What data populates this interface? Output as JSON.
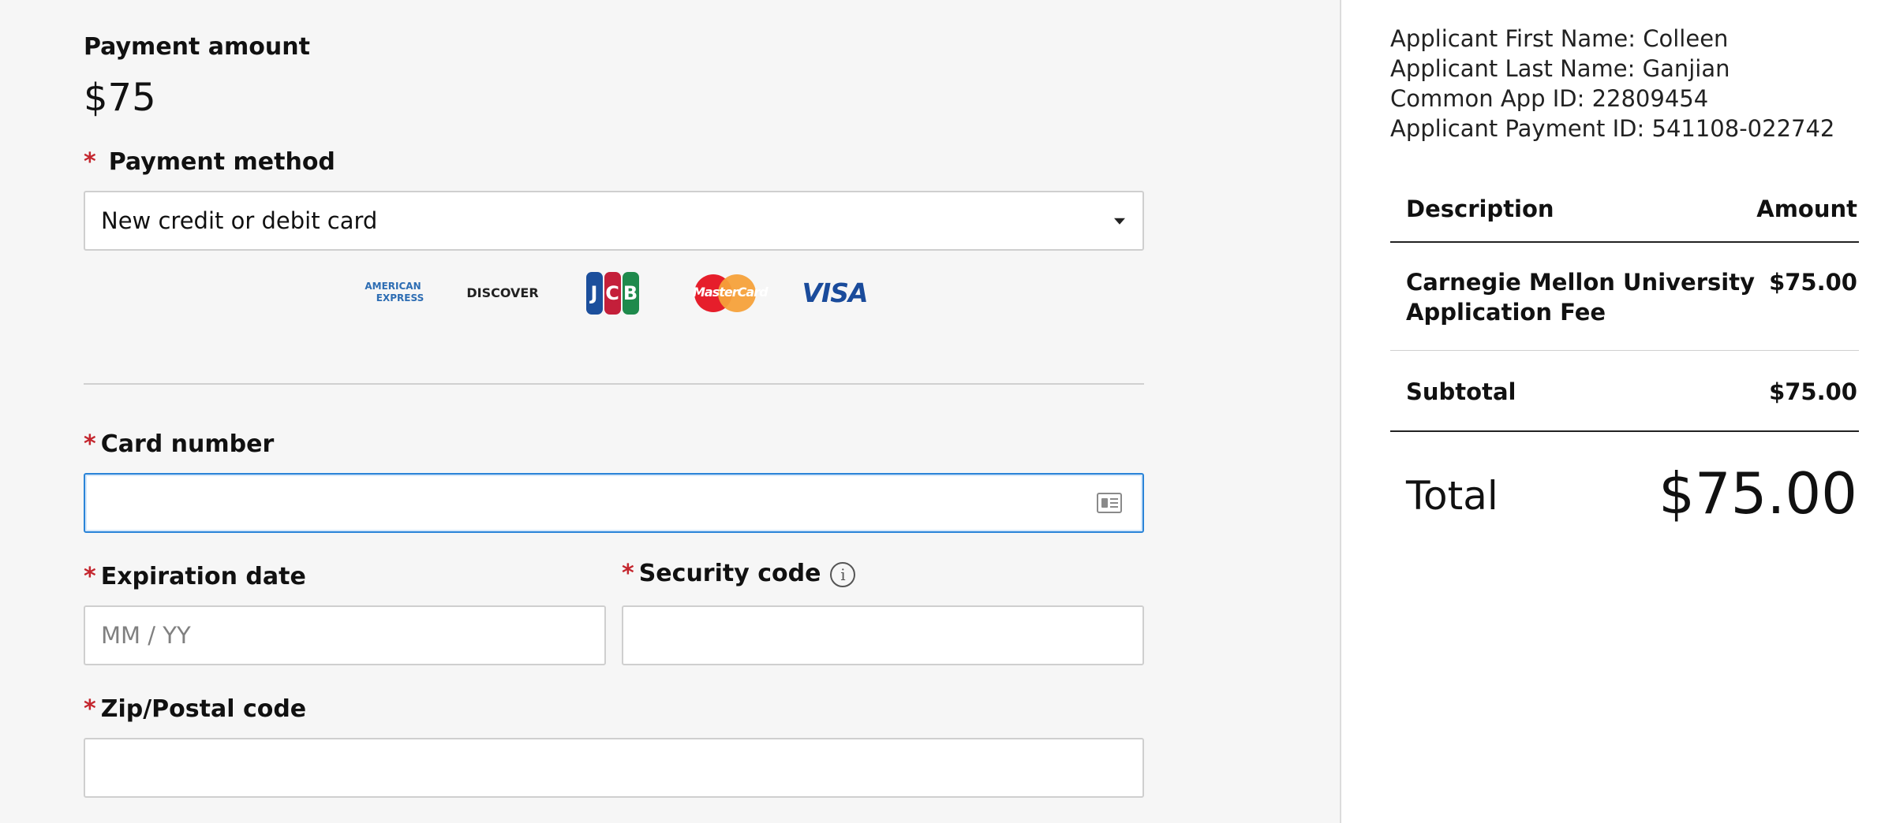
{
  "payment": {
    "amount_label": "Payment amount",
    "amount_value": "$75",
    "method_label": "Payment method",
    "method_selected": "New credit or debit card",
    "required_mark": "*"
  },
  "card_brands": {
    "amex_line1": "AMERICAN",
    "amex_line2": "EXPRESS",
    "discover": "DISCOVER",
    "jcb_letters": [
      "J",
      "C",
      "B"
    ],
    "mastercard": "MasterCard",
    "visa": "VISA"
  },
  "card_form": {
    "card_number_label": "Card number",
    "card_number_value": "",
    "expiration_label": "Expiration date",
    "expiration_placeholder": "MM / YY",
    "security_label": "Security code",
    "security_info_glyph": "i",
    "zip_label": "Zip/Postal code",
    "zip_value": ""
  },
  "applicant": {
    "first_name_line": "Applicant First Name: Colleen",
    "last_name_line": "Applicant Last Name: Ganjian",
    "common_app_line": "Common App ID: 22809454",
    "payment_id_line": "Applicant Payment ID: 541108-022742"
  },
  "summary": {
    "col_description": "Description",
    "col_amount": "Amount",
    "items": [
      {
        "description_line1": "Carnegie Mellon University",
        "description_line2": "Application Fee",
        "amount": "$75.00"
      }
    ],
    "subtotal_label": "Subtotal",
    "subtotal_value": "$75.00",
    "total_label": "Total",
    "total_value": "$75.00"
  },
  "colors": {
    "required": "#c4262e",
    "focus_border": "#2a84d8",
    "left_background": "#f6f6f6"
  },
  "icons": [
    "card-id-icon",
    "info-icon",
    "chevron-down-icon"
  ]
}
